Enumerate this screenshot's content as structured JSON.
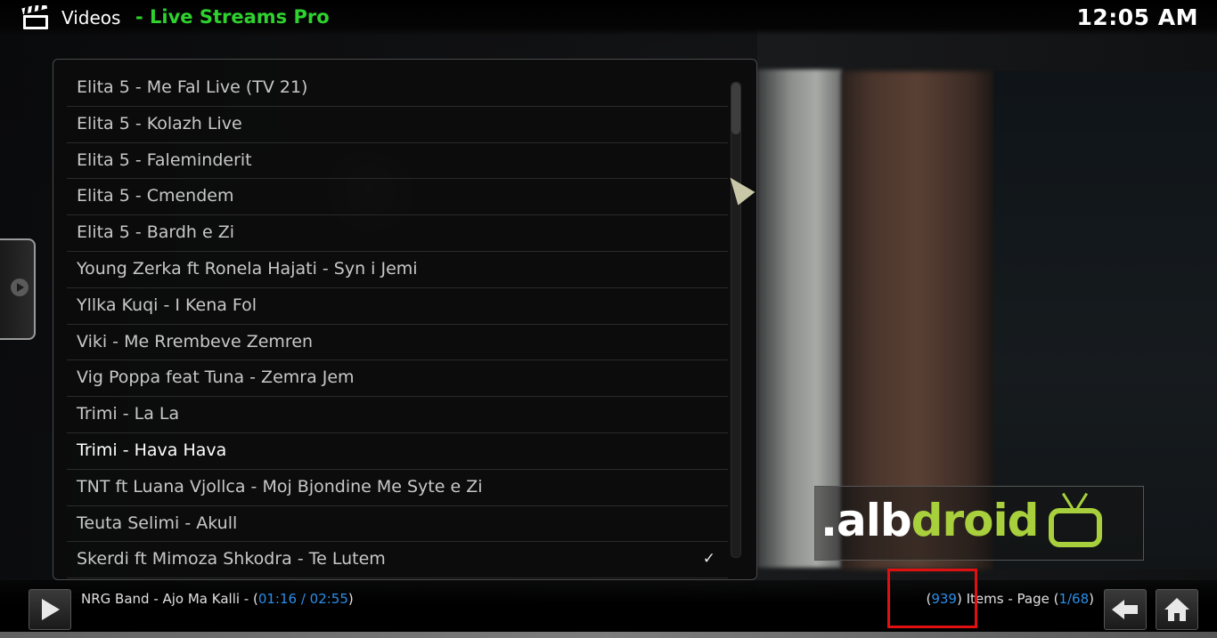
{
  "header": {
    "section": "Videos",
    "addon": "- Live Streams Pro",
    "clock": "12:05 AM"
  },
  "list": {
    "items": [
      {
        "label": "Elita 5 - Me Fal Live (TV 21)",
        "checked": false
      },
      {
        "label": "Elita 5 - Kolazh Live",
        "checked": false
      },
      {
        "label": "Elita 5 - Faleminderit",
        "checked": false
      },
      {
        "label": "Elita 5 - Cmendem",
        "checked": false
      },
      {
        "label": "Elita 5 - Bardh e Zi",
        "checked": false
      },
      {
        "label": "Young Zerka ft  Ronela Hajati - Syn i Jemi",
        "checked": false
      },
      {
        "label": "Yllka Kuqi - I Kena Fol",
        "checked": false
      },
      {
        "label": "Viki - Me Rrembeve Zemren",
        "checked": false
      },
      {
        "label": "Vig Poppa feat  Tuna - Zemra Jem",
        "checked": false
      },
      {
        "label": "Trimi - La La",
        "checked": false
      },
      {
        "label": "Trimi - Hava Hava",
        "checked": false,
        "highlight": true
      },
      {
        "label": "TNT ft Luana Vjollca - Moj Bjondine Me Syte e Zi",
        "checked": false
      },
      {
        "label": "Teuta Selimi - Akull",
        "checked": false
      },
      {
        "label": "Skerdi ft  Mimoza Shkodra - Te Lutem",
        "checked": true
      }
    ],
    "check_glyph": "✓"
  },
  "watermark": {
    "prefix": ".alb",
    "suffix": "droid"
  },
  "footer": {
    "now_playing_title": "NRG Band - Ajo Ma Kalli - (",
    "now_playing_time": "01:16 / 02:55",
    "now_playing_close": ")",
    "items_open": "(",
    "items_count": "939",
    "items_mid": ") Items - Page (",
    "page": "1/68",
    "items_close": ")"
  },
  "icons": {
    "header": "clapperboard-icon",
    "side": "arrow-right-icon",
    "play": "play-icon",
    "back": "back-arrow-icon",
    "home": "home-icon"
  },
  "colors": {
    "addon_green": "#2ed22e",
    "accent_blue": "#2a8ee8",
    "watermark_green": "#a8cf3c",
    "highlight_box": "#e01010"
  }
}
